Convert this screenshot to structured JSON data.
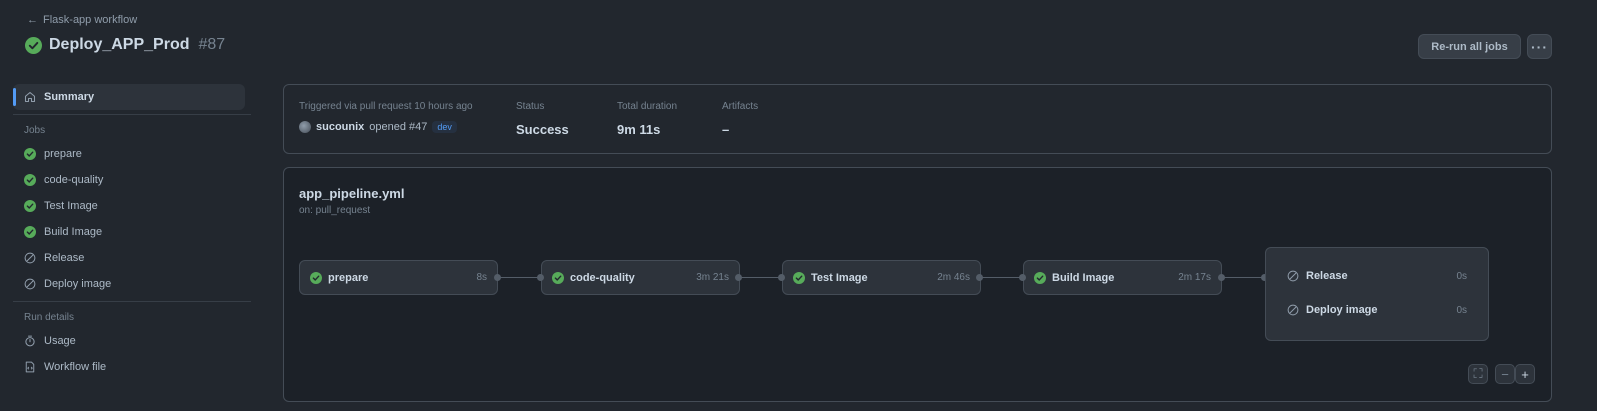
{
  "header": {
    "back_label": "Flask-app workflow",
    "title": "Deploy_APP_Prod",
    "run_number": "#87",
    "rerun_label": "Re-run all jobs",
    "more_label": "···"
  },
  "sidebar": {
    "summary_label": "Summary",
    "jobs_heading": "Jobs",
    "jobs": [
      {
        "label": "prepare",
        "status": "success"
      },
      {
        "label": "code-quality",
        "status": "success"
      },
      {
        "label": "Test Image",
        "status": "success"
      },
      {
        "label": "Build Image",
        "status": "success"
      },
      {
        "label": "Release",
        "status": "skipped"
      },
      {
        "label": "Deploy image",
        "status": "skipped"
      }
    ],
    "run_details_heading": "Run details",
    "usage_label": "Usage",
    "workflow_file_label": "Workflow file"
  },
  "summary": {
    "trigger_label": "Triggered via pull request 10 hours ago",
    "user": "sucounix",
    "action": "opened",
    "pr": "#47",
    "branch": "dev",
    "status_label": "Status",
    "status_value": "Success",
    "duration_label": "Total duration",
    "duration_value": "9m 11s",
    "artifacts_label": "Artifacts",
    "artifacts_value": "–"
  },
  "graph": {
    "workflow_file": "app_pipeline.yml",
    "trigger": "on: pull_request",
    "jobs": [
      {
        "name": "prepare",
        "time": "8s"
      },
      {
        "name": "code-quality",
        "time": "3m 21s"
      },
      {
        "name": "Test Image",
        "time": "2m 46s"
      },
      {
        "name": "Build Image",
        "time": "2m 17s"
      }
    ],
    "group_jobs": [
      {
        "name": "Release",
        "time": "0s"
      },
      {
        "name": "Deploy image",
        "time": "0s"
      }
    ]
  },
  "colors": {
    "success": "#57ab5a",
    "accent": "#539bf5",
    "skipped": "#768390"
  }
}
